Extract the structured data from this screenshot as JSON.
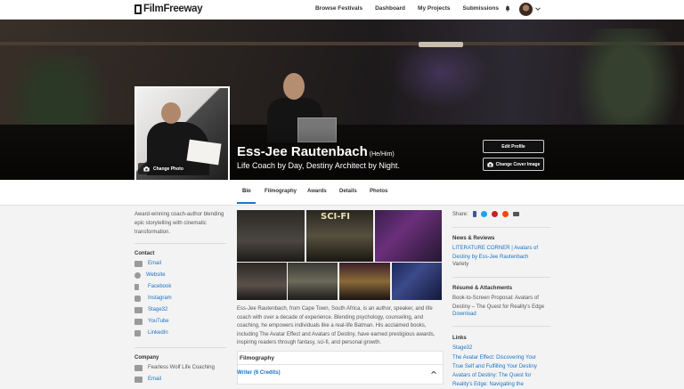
{
  "nav": {
    "logo": "FilmFreeway",
    "links": [
      "Browse Festivals",
      "Dashboard",
      "My Projects",
      "Submissions"
    ]
  },
  "profile": {
    "name": "Ess-Jee Rautenbach",
    "pronouns": "(He/Him)",
    "tagline": "Life Coach by Day, Destiny Architect by Night.",
    "change_photo": "Change Photo",
    "edit_profile": "Edit Profile",
    "change_cover": "Change Cover Image"
  },
  "tabs": [
    "Bio",
    "Filmography",
    "Awards",
    "Details",
    "Photos"
  ],
  "left": {
    "short_bio": "Award-winning coach-author blending epic storytelling with cinematic transformation.",
    "contact_title": "Contact",
    "contact": [
      "Email",
      "Website",
      "Facebook",
      "Instagram",
      "Stage32",
      "YouTube",
      "LinkedIn"
    ],
    "company_title": "Company",
    "company_name": "Fearless Wolf Life Coaching",
    "company_email": "Email"
  },
  "center": {
    "photo_overlay_text": "SCI-FI",
    "long_bio": "Ess-Jee Rautenbach, from Cape Town, South Africa, is an author, speaker, and life coach with over a decade of experience. Blending psychology, counseling, and coaching, he empowers individuals like a real-life Batman. His acclaimed books, including The Avatar Effect and Avatars of Destiny, have earned prestigious awards, inspiring readers through fantasy, sci-fi, and personal growth.",
    "filmography_title": "Filmography",
    "writer_credits": "Writer (6 Credits)"
  },
  "right": {
    "share_label": "Share:",
    "news_title": "News & Reviews",
    "news_link": "LITERATURE CORNER | Avatars of Destiny by Ess-Jee Rautenbach",
    "news_source": "Variety",
    "resume_title": "Résumé & Attachments",
    "resume_text": "Book-to-Screen Proposal: Avatars of Destiny – The Quest for Reality's Edge",
    "resume_download": "Download",
    "links_title": "Links",
    "links": [
      "Stage32",
      "The Avatar Effect: Discovering Your True Self and Fulfilling Your Destiny",
      "Avatars of Destiny: The Quest for Reality's Edge: Navigating the"
    ]
  },
  "colors": {
    "accent": "#1a73c6",
    "share_facebook": "#3b5998",
    "share_twitter": "#1da1f2",
    "share_pinterest": "#cb2027",
    "share_reddit": "#ff4500",
    "share_email": "#555555"
  }
}
